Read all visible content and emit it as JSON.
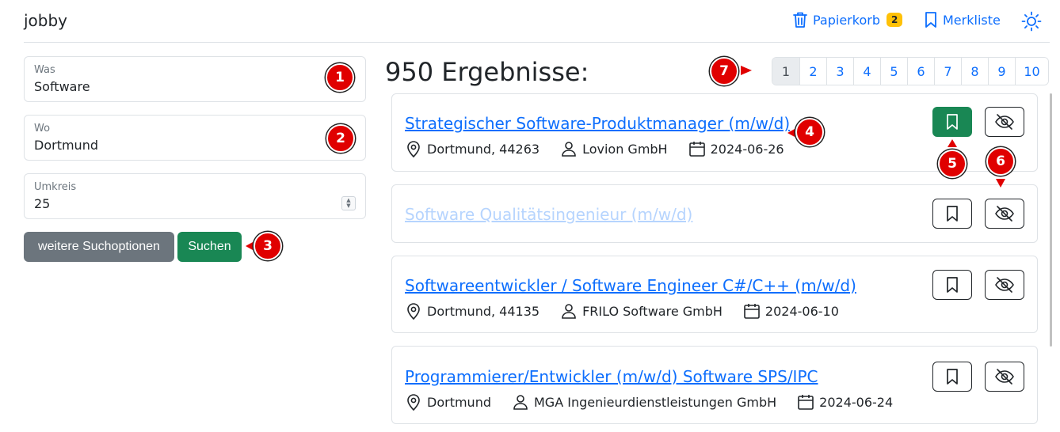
{
  "app": {
    "brand": "jobby"
  },
  "nav": {
    "trash_label": "Papierkorb",
    "trash_count": "2",
    "watchlist_label": "Merkliste"
  },
  "search": {
    "was_label": "Was",
    "was_value": "Software",
    "wo_label": "Wo",
    "wo_value": "Dortmund",
    "umkreis_label": "Umkreis",
    "umkreis_value": "25",
    "more_options_label": "weitere Suchoptionen",
    "submit_label": "Suchen"
  },
  "results": {
    "title": "950 Ergebnisse:",
    "pages": [
      "1",
      "2",
      "3",
      "4",
      "5",
      "6",
      "7",
      "8",
      "9",
      "10"
    ],
    "current_page": "1",
    "jobs": [
      {
        "title": "Strategischer Software-Produktmanager (m/w/d)",
        "location": "Dortmund, 44263",
        "company": "Lovion GmbH",
        "date": "2024-06-26",
        "bookmarked": true,
        "hidden": false
      },
      {
        "title": "Software Qualitätsingenieur (m/w/d)",
        "bookmarked": false,
        "hidden": true
      },
      {
        "title": "Softwareentwickler / Software Engineer C#/C++ (m/w/d)",
        "location": "Dortmund, 44135",
        "company": "FRILO Software GmbH",
        "date": "2024-06-10",
        "bookmarked": false,
        "hidden": false
      },
      {
        "title": "Programmierer/Entwickler (m/w/d) Software SPS/IPC",
        "location": "Dortmund",
        "company": "MGA Ingenieurdienstleistungen GmbH",
        "date": "2024-06-24",
        "bookmarked": false,
        "hidden": false
      }
    ]
  },
  "markers": [
    "1",
    "2",
    "3",
    "4",
    "5",
    "6",
    "7"
  ],
  "colors": {
    "primary": "#0d6efd",
    "success": "#198754",
    "secondary": "#6c757d",
    "warning": "#ffc107",
    "marker": "#e00000"
  }
}
